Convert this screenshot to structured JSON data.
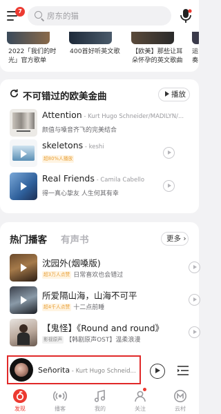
{
  "header": {
    "menu_badge": "7",
    "search_placeholder": "房东的猫"
  },
  "playlists": [
    {
      "caption_line1": "2022「我们的时",
      "caption_line2": "光」官方歌单"
    },
    {
      "caption_line1": "400首好听英文歌",
      "caption_line2": ""
    },
    {
      "caption_line1": "【欧美】那些让耳",
      "caption_line2": "朵怀孕的英文歌曲"
    },
    {
      "caption_line1": "运",
      "caption_line2": "奏"
    }
  ],
  "section1": {
    "title": "不可错过的欧美金曲",
    "play_label": "播放",
    "songs": [
      {
        "name": "Attention",
        "artist": " - Kurt Hugo Schneider/MADILYN/...",
        "tag": "",
        "desc": "颜值与嗓音齐飞的完美结合"
      },
      {
        "name": "skeletons",
        "artist": " - keshi",
        "tag": "超80%人播放",
        "desc": ""
      },
      {
        "name": "Real Friends",
        "artist": " - Camila Cabello",
        "tag": "",
        "desc": "得一真心挚友 人生何其有幸"
      }
    ]
  },
  "section2": {
    "tab_hot": "热门播客",
    "tab_audio": "有声书",
    "more_label": "更多",
    "programs": [
      {
        "name": "沈园外(烟嗓版)",
        "tag": "超3万人点赞",
        "desc": "日常喜欢也会错过"
      },
      {
        "name": "所爱隔山海，山海不可平",
        "tag": "超4千人点赞",
        "desc": "十二点前睡"
      },
      {
        "name": "【鬼怪】《Round and round》",
        "tag": "影视原声",
        "desc": "【韩剧原声OST】温柔浪漫"
      }
    ]
  },
  "player": {
    "title": "Señorita",
    "artist": " - Kurt Hugo Schneid..."
  },
  "nav": [
    {
      "label": "发现",
      "icon": "discover-icon",
      "active": true
    },
    {
      "label": "播客",
      "icon": "podcast-icon",
      "active": false
    },
    {
      "label": "我的",
      "icon": "music-icon",
      "active": false
    },
    {
      "label": "关注",
      "icon": "follow-icon",
      "active": false
    },
    {
      "label": "云村",
      "icon": "cloud-village-icon",
      "active": false
    }
  ],
  "colors": {
    "accent": "#ec3a31",
    "highlight": "#e02828"
  }
}
